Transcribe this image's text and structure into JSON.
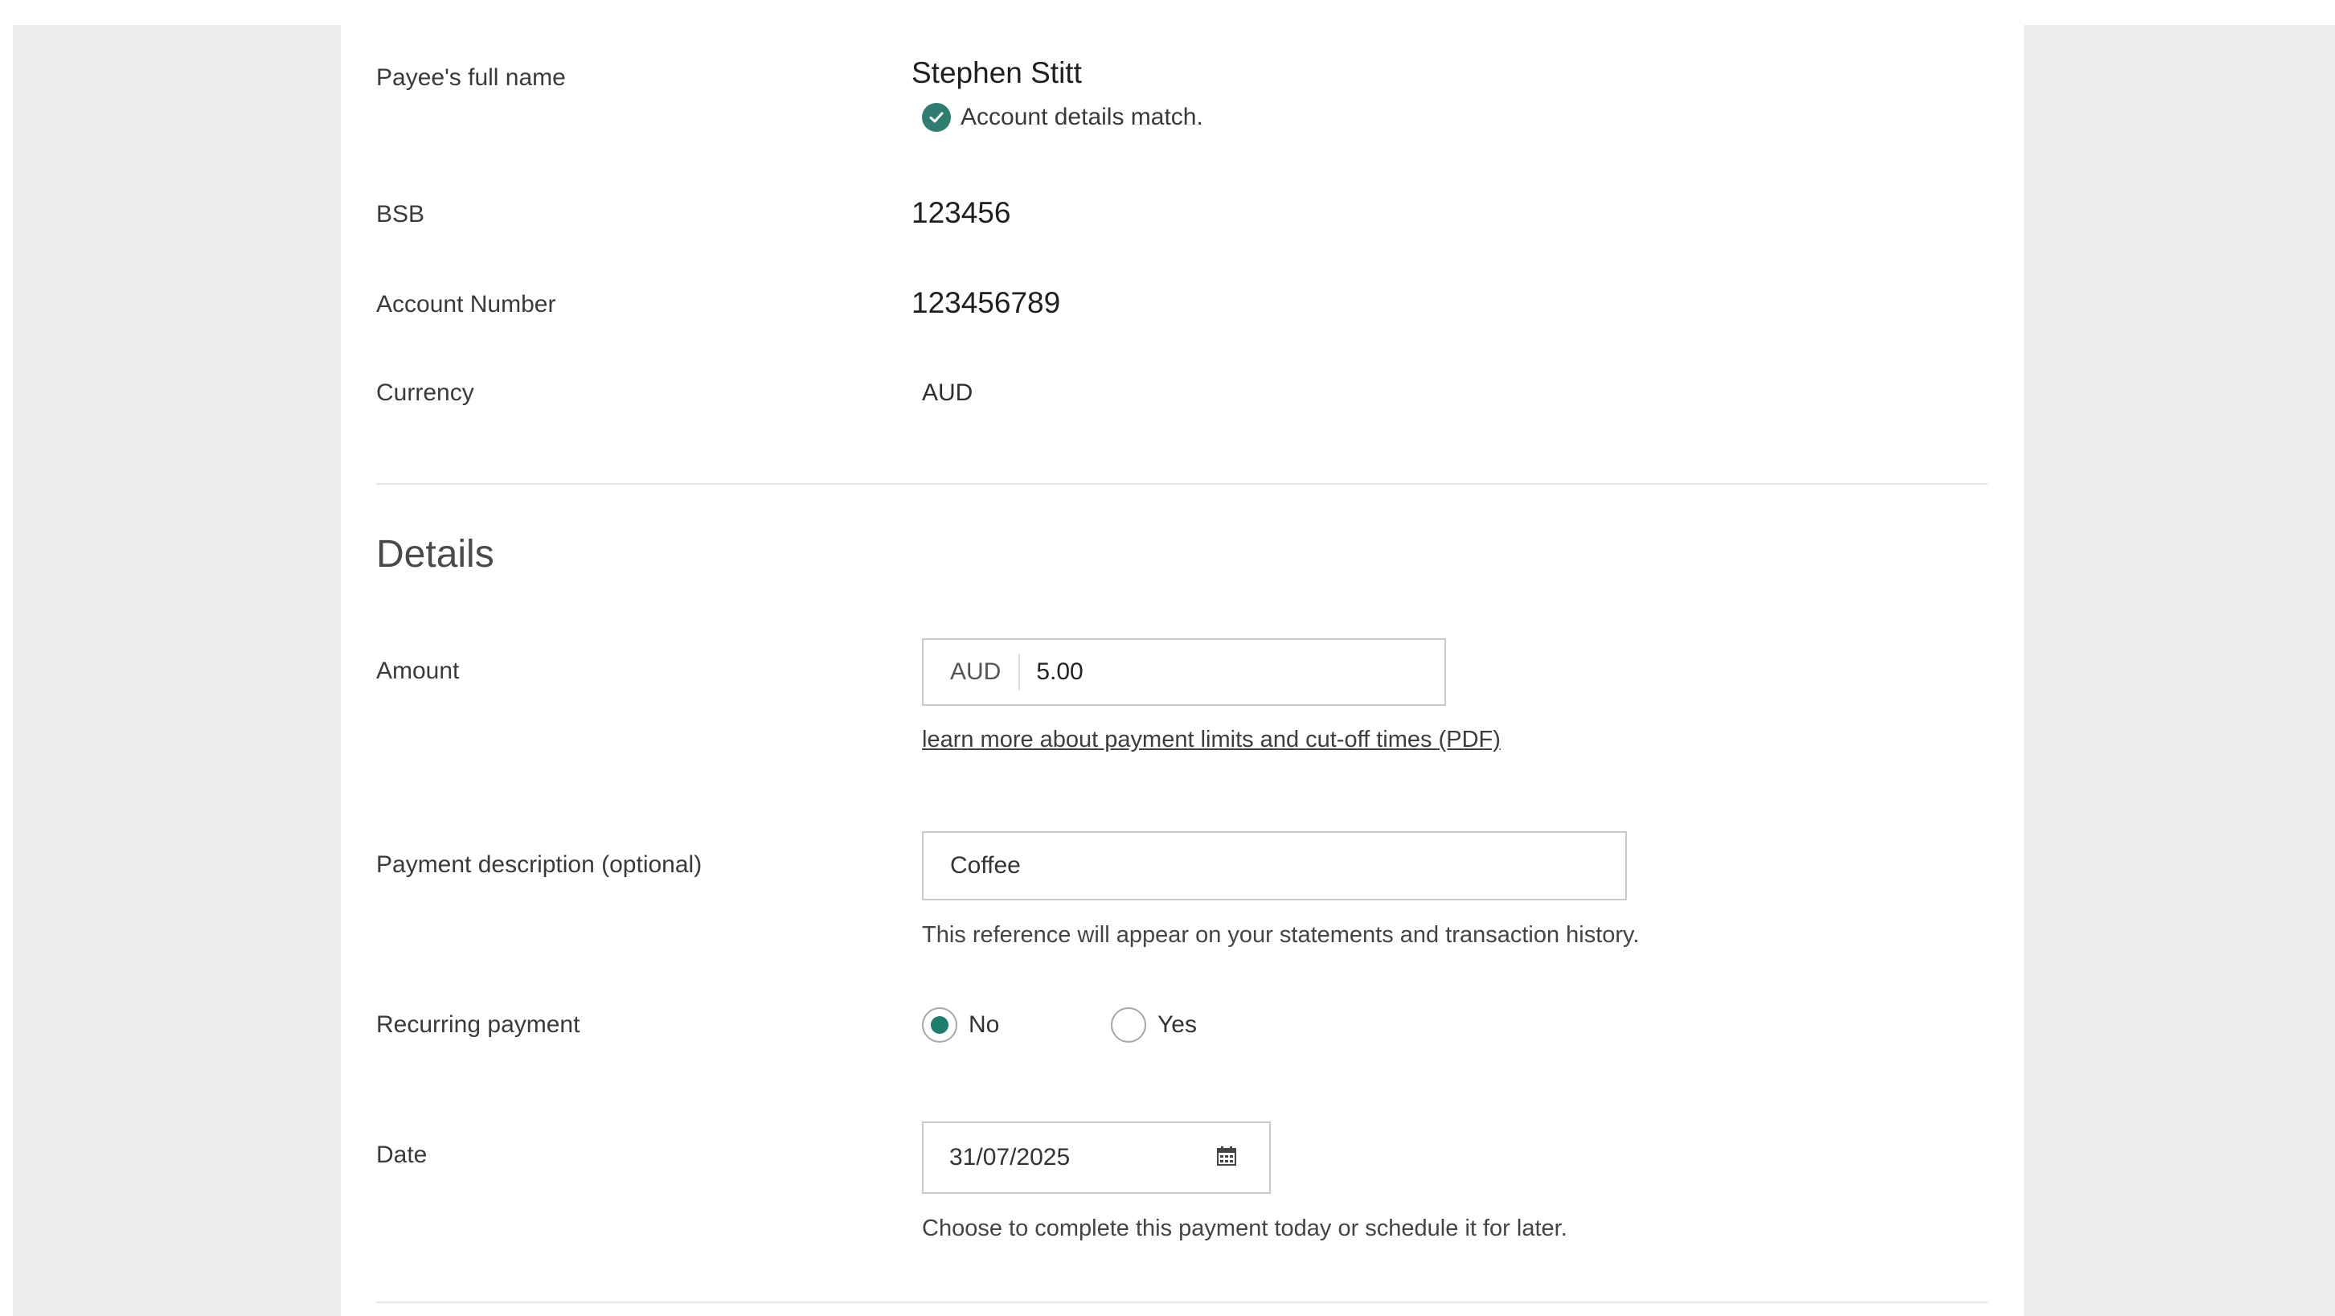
{
  "payee": {
    "name_label": "Payee's full name",
    "name_value": "Stephen Stitt",
    "match_text": "Account details match.",
    "bsb_label": "BSB",
    "bsb_value": "123456",
    "account_label": "Account Number",
    "account_value": "123456789",
    "currency_label": "Currency",
    "currency_value": "AUD"
  },
  "details": {
    "title": "Details",
    "amount_label": "Amount",
    "amount_currency": "AUD",
    "amount_value": "5.00",
    "limits_link": "learn more about payment limits and cut-off times (PDF)",
    "description_label": "Payment description (optional)",
    "description_value": "Coffee",
    "description_hint": "This reference will appear on your statements and transaction history.",
    "recurring_label": "Recurring payment",
    "recurring_options": [
      "No",
      "Yes"
    ],
    "recurring_selected": "No",
    "date_label": "Date",
    "date_value": "31/07/2025",
    "date_hint": "Choose to complete this payment today or schedule it for later."
  },
  "colors": {
    "accent": "#1f7d6e",
    "check_badge": "#2e7d70",
    "backdrop": "#ececec",
    "input_border": "#c9c9c9"
  },
  "icons": {
    "match": "check-circle-icon",
    "date": "calendar-icon"
  }
}
